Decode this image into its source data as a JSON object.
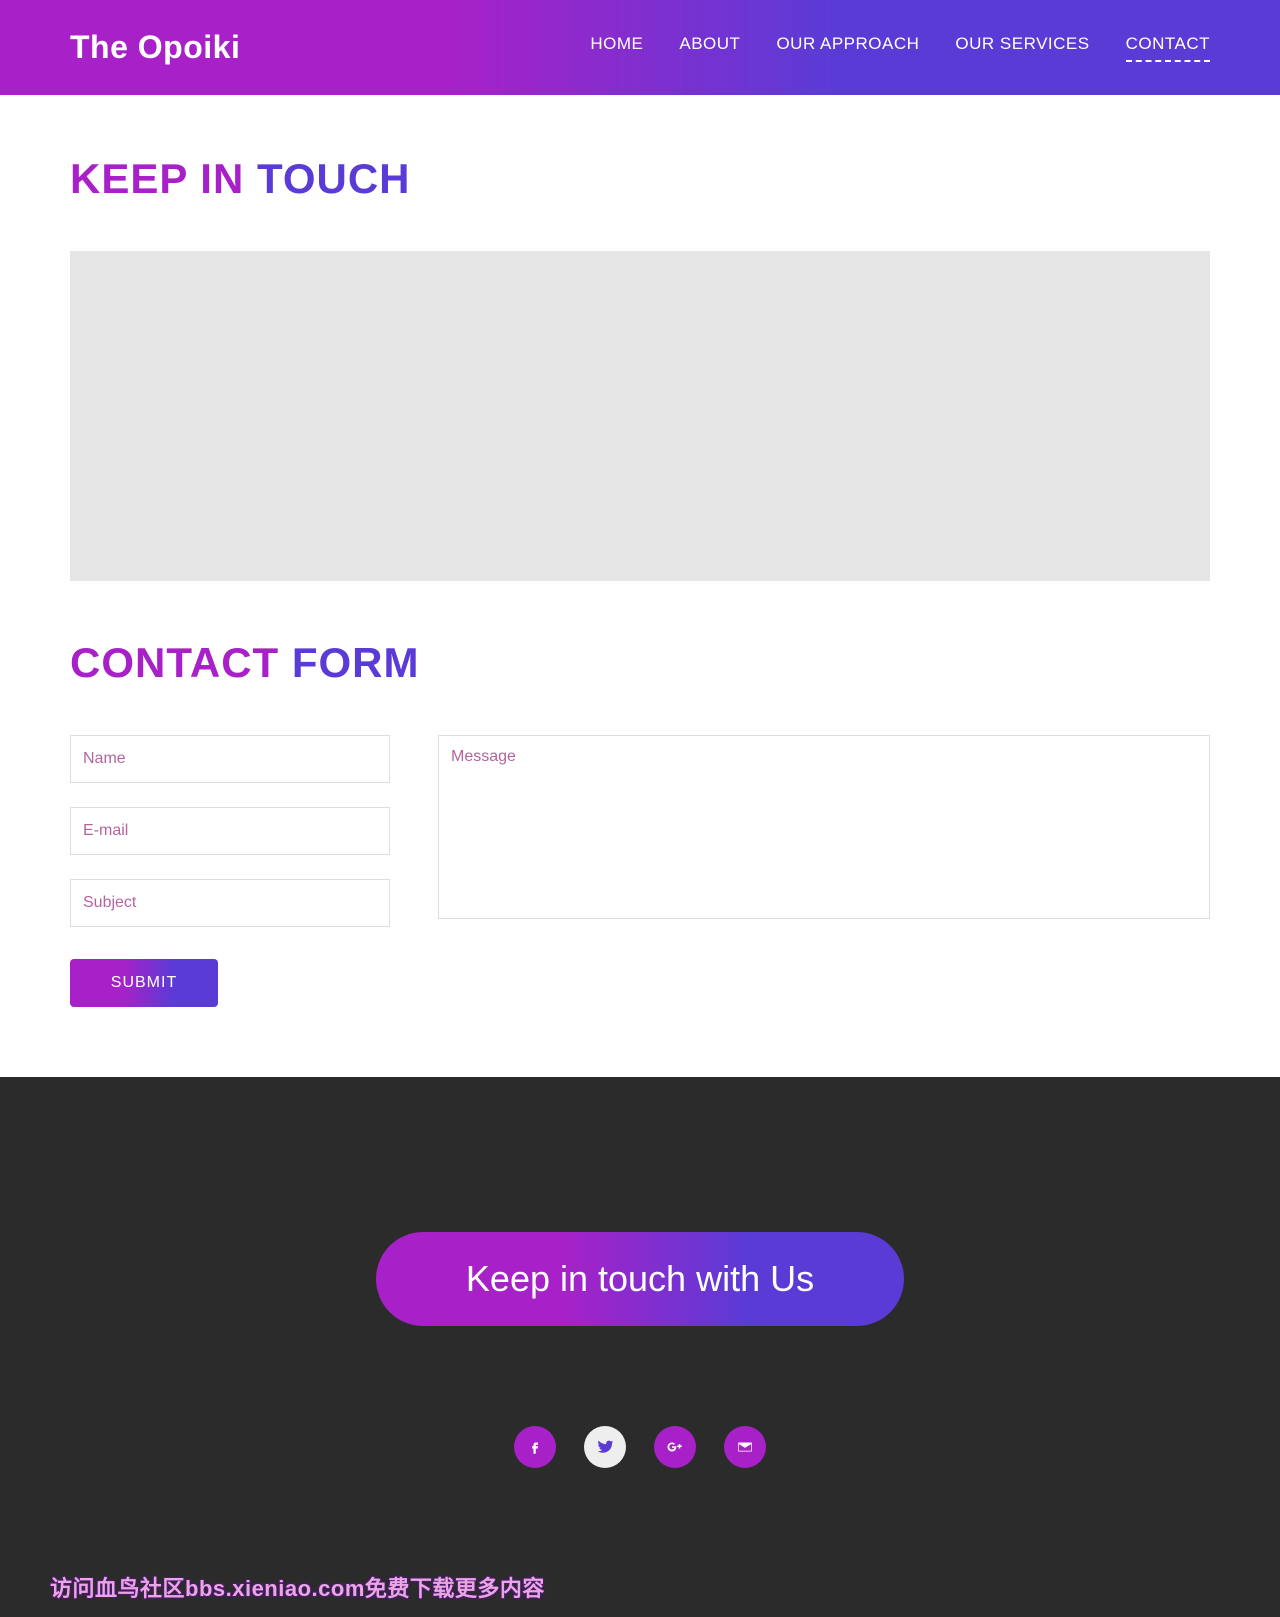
{
  "header": {
    "logo": "The Opoiki",
    "nav": [
      {
        "label": "HOME",
        "active": false
      },
      {
        "label": "ABOUT",
        "active": false
      },
      {
        "label": "OUR APPROACH",
        "active": false
      },
      {
        "label": "OUR SERVICES",
        "active": false
      },
      {
        "label": "CONTACT",
        "active": true
      }
    ]
  },
  "sections": {
    "keep_in_touch": {
      "part1": "KEEP IN ",
      "part2": "TOUCH"
    },
    "contact_form": {
      "part1": "CONTACT ",
      "part2": "FORM"
    }
  },
  "form": {
    "name_placeholder": "Name",
    "email_placeholder": "E-mail",
    "subject_placeholder": "Subject",
    "message_placeholder": "Message",
    "submit_label": "SUBMIT"
  },
  "footer": {
    "cta_label": "Keep in touch with Us",
    "socials": {
      "facebook": "facebook-icon",
      "twitter": "twitter-icon",
      "googleplus": "googleplus-icon",
      "mail": "mail-icon"
    },
    "watermark": "访问血鸟社区bbs.xieniao.com免费下载更多内容"
  }
}
